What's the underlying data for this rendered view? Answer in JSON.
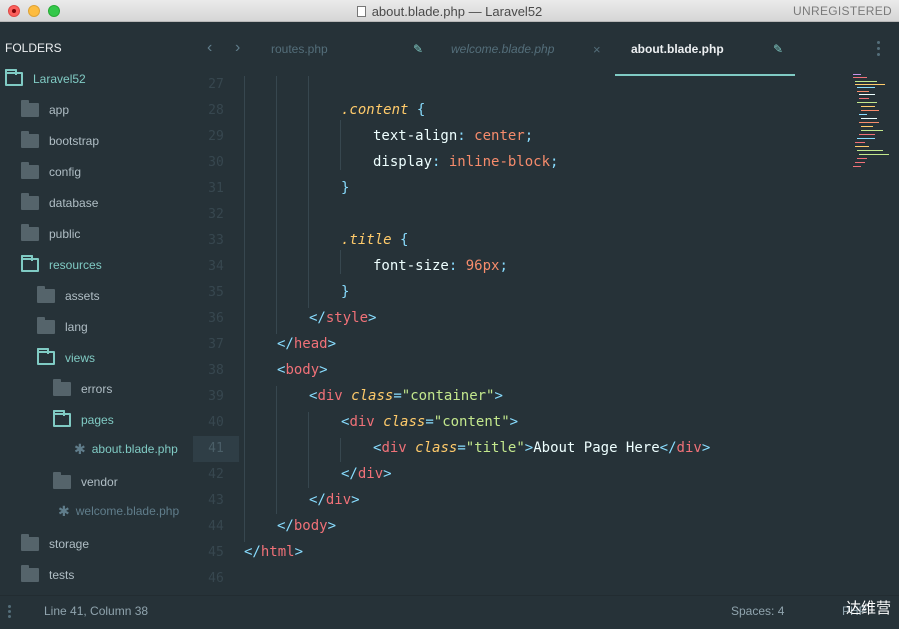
{
  "window": {
    "title": "about.blade.php — Laravel52",
    "unregistered": "UNREGISTERED"
  },
  "sidebar": {
    "header": "FOLDERS",
    "items": [
      {
        "label": "Laravel52",
        "type": "folder-open"
      },
      {
        "label": "app",
        "type": "folder"
      },
      {
        "label": "bootstrap",
        "type": "folder"
      },
      {
        "label": "config",
        "type": "folder"
      },
      {
        "label": "database",
        "type": "folder"
      },
      {
        "label": "public",
        "type": "folder"
      },
      {
        "label": "resources",
        "type": "folder-open"
      },
      {
        "label": "assets",
        "type": "folder"
      },
      {
        "label": "lang",
        "type": "folder"
      },
      {
        "label": "views",
        "type": "folder-open"
      },
      {
        "label": "errors",
        "type": "folder"
      },
      {
        "label": "pages",
        "type": "folder-open"
      },
      {
        "label": "about.blade.php",
        "type": "file-active"
      },
      {
        "label": "vendor",
        "type": "folder"
      },
      {
        "label": "welcome.blade.php",
        "type": "file"
      },
      {
        "label": "storage",
        "type": "folder"
      },
      {
        "label": "tests",
        "type": "folder"
      }
    ]
  },
  "tabs": [
    {
      "label": "routes.php",
      "state": "inactive",
      "action_icon": "pencil-icon"
    },
    {
      "label": "welcome.blade.php",
      "state": "preview",
      "action_icon": "close-icon"
    },
    {
      "label": "about.blade.php",
      "state": "active",
      "action_icon": "pencil-icon"
    }
  ],
  "editor": {
    "line_numbers": [
      "27",
      "28",
      "29",
      "30",
      "31",
      "32",
      "33",
      "34",
      "35",
      "36",
      "37",
      "38",
      "39",
      "40",
      "41",
      "42",
      "43",
      "44",
      "45",
      "46"
    ],
    "current_line": "41",
    "code": {
      "l28_sel": ".content",
      "l28_brace": " {",
      "l29_prop": "text-align",
      "l29_colon": ": ",
      "l29_val": "center",
      "l29_semi": ";",
      "l30_prop": "display",
      "l30_colon": ": ",
      "l30_val": "inline-block",
      "l30_semi": ";",
      "l31": "}",
      "l33_sel": ".title",
      "l33_brace": " {",
      "l34_prop": "font-size",
      "l34_colon": ": ",
      "l34_val": "96px",
      "l34_semi": ";",
      "l35": "}",
      "l36_open": "</",
      "l36_tag": "style",
      "l36_close": ">",
      "l37_open": "</",
      "l37_tag": "head",
      "l37_close": ">",
      "l38_open": "<",
      "l38_tag": "body",
      "l38_close": ">",
      "l39_open": "<",
      "l39_tag": "div",
      "l39_attr": "class",
      "l39_eq": "=",
      "l39_str": "\"container\"",
      "l39_close": ">",
      "l40_open": "<",
      "l40_tag": "div",
      "l40_attr": "class",
      "l40_eq": "=",
      "l40_str": "\"content\"",
      "l40_close": ">",
      "l41_open": "<",
      "l41_tag": "div",
      "l41_attr": "class",
      "l41_eq": "=",
      "l41_str": "\"title\"",
      "l41_close": ">",
      "l41_text": "About Page Here",
      "l41_end_open": "</",
      "l41_end_tag": "div",
      "l41_end_close": ">",
      "l42_open": "</",
      "l42_tag": "div",
      "l42_close": ">",
      "l43_open": "</",
      "l43_tag": "div",
      "l43_close": ">",
      "l44_open": "</",
      "l44_tag": "body",
      "l44_close": ">",
      "l45_open": "</",
      "l45_tag": "html",
      "l45_close": ">"
    }
  },
  "status": {
    "position": "Line 41, Column 38",
    "spaces": "Spaces: 4",
    "syntax": "PHP"
  },
  "watermark": "达维营",
  "colors": {
    "background": "#263238",
    "accent": "#80cbc4",
    "tag": "#f07178",
    "attribute": "#ffcb6b",
    "string": "#c3e88d",
    "value": "#f78c6c",
    "punctuation": "#89ddff"
  }
}
